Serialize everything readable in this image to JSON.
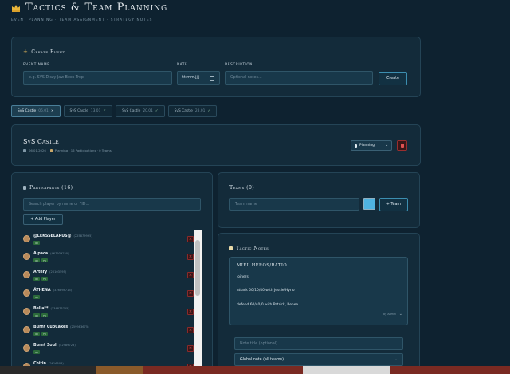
{
  "header": {
    "title": "Tactics & Team Planning",
    "subtitle": "EVENT PLANNING · TEAM ASSIGNMENT · STRATEGY NOTES"
  },
  "create_event": {
    "title": "Create Event",
    "event_name_label": "EVENT NAME",
    "event_name_placeholder": "e.g. SVS Diszy Jaw Bees Trop",
    "date_label": "DATE",
    "date_placeholder": "tt.mm.jjjj",
    "description_label": "DESCRIPTION",
    "description_placeholder": "Optional notes...",
    "create_button": "Create"
  },
  "event_tabs": [
    {
      "name": "SvS Castle",
      "date": "06.01",
      "active": true,
      "mark": "×"
    },
    {
      "name": "SvS Castle",
      "date": "13.01",
      "active": false,
      "mark": "✓"
    },
    {
      "name": "SvS Castle",
      "date": "20.01",
      "active": false,
      "mark": "✓"
    },
    {
      "name": "SvS Castle",
      "date": "28.01",
      "active": false,
      "mark": "✓"
    }
  ],
  "event": {
    "title": "SvS Castle",
    "meta_date": "06.01.2026",
    "meta_info": "Planning · 16 Participations · 0 Teams",
    "status": "Planning"
  },
  "participants": {
    "title": "Participants (16)",
    "search_placeholder": "Search player by name or FID...",
    "add_button": "+ Add Player",
    "items": [
      {
        "name": "@LEKSSELARUS@",
        "id": "(225879995)",
        "badges": [
          "60"
        ]
      },
      {
        "name": "Alpaca",
        "id": "(467939220)",
        "badges": [
          "60",
          "FR"
        ]
      },
      {
        "name": "Artery",
        "id": "(20103595)",
        "badges": [
          "60",
          "FR"
        ]
      },
      {
        "name": "ÄTHENA",
        "id": "(326898713)",
        "badges": [
          "60"
        ]
      },
      {
        "name": "Bella**",
        "id": "(134876755)",
        "badges": [
          "60",
          "FR"
        ]
      },
      {
        "name": "Burnt CupCakes",
        "id": "(259983675)",
        "badges": [
          "60",
          "FR"
        ]
      },
      {
        "name": "Burnt Soul",
        "id": "(52989723)",
        "badges": [
          "60"
        ]
      },
      {
        "name": "Chitin",
        "id": "(2616508)",
        "badges": []
      }
    ]
  },
  "teams": {
    "title": "Teams (0)",
    "name_placeholder": "Team name",
    "color": "#4fb3e0",
    "add_button": "+ Team"
  },
  "tactic_notes": {
    "title": "Tactic Notes",
    "note_title": "MIEL HEROS/RATIO",
    "lines": [
      "Joiners",
      "attack 50/10/40 with Jessie/Hyrlo",
      "defend 60/40/0 with Patrick, Renee"
    ],
    "author": "by Admin",
    "note_title_placeholder": "Note title (optional)",
    "scope_select": "Global note (all teams)"
  }
}
